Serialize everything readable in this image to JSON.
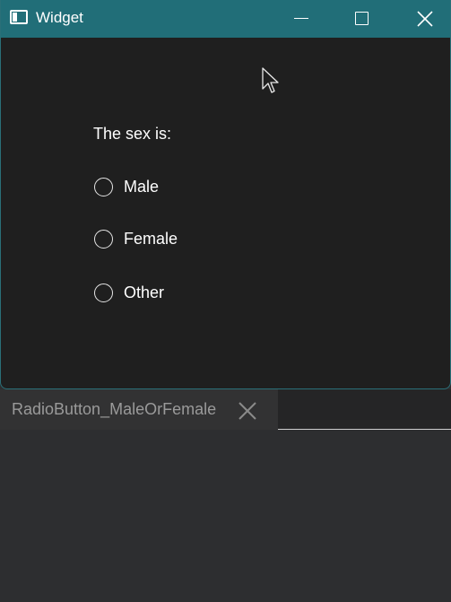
{
  "window": {
    "title": "Widget",
    "icon": "window-app-icon",
    "controls": [
      "minimize-icon",
      "maximize-icon",
      "close-icon"
    ],
    "accent_color": "#216e78",
    "background_color": "#1f1f1f"
  },
  "form": {
    "label": "The sex is:",
    "options": [
      {
        "label": "Male",
        "checked": false
      },
      {
        "label": "Female",
        "checked": false
      },
      {
        "label": "Other",
        "checked": false
      }
    ]
  },
  "editor": {
    "tab_label": "RadioButton_MaleOrFemale",
    "tab_close_icon": "close-icon"
  }
}
